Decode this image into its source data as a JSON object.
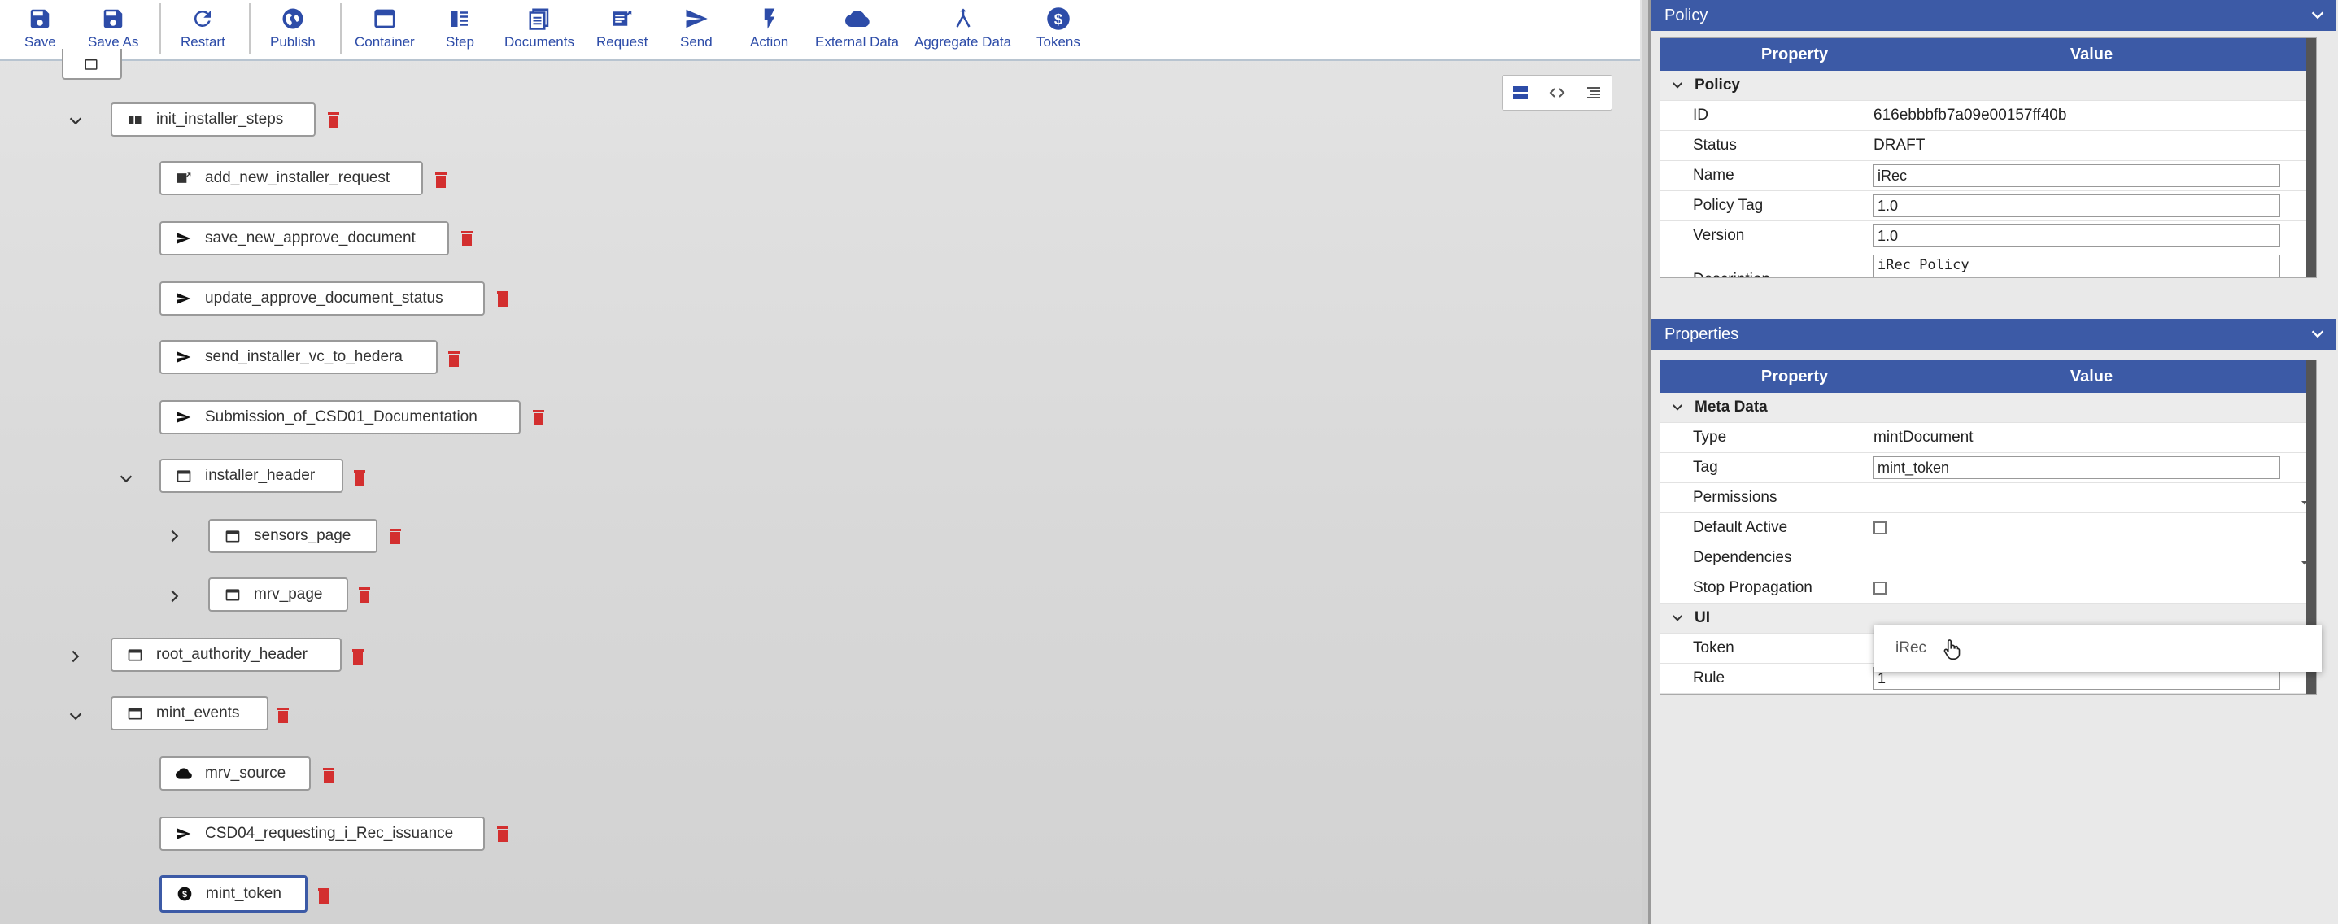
{
  "toolbar": {
    "items": [
      {
        "label": "Save",
        "icon": "save-icon"
      },
      {
        "label": "Save As",
        "icon": "save-as-icon"
      },
      {
        "label": "Restart",
        "icon": "restart-icon"
      },
      {
        "label": "Publish",
        "icon": "globe-icon"
      },
      {
        "label": "Container",
        "icon": "container-icon"
      },
      {
        "label": "Step",
        "icon": "step-icon"
      },
      {
        "label": "Documents",
        "icon": "documents-icon"
      },
      {
        "label": "Request",
        "icon": "request-icon"
      },
      {
        "label": "Send",
        "icon": "send-icon"
      },
      {
        "label": "Action",
        "icon": "lightning-icon"
      },
      {
        "label": "External Data",
        "icon": "cloud-icon"
      },
      {
        "label": "Aggregate Data",
        "icon": "merge-icon"
      },
      {
        "label": "Tokens",
        "icon": "dollar-icon"
      }
    ]
  },
  "tree": {
    "nodes": [
      {
        "label": "init_installer_steps"
      },
      {
        "label": "add_new_installer_request"
      },
      {
        "label": "save_new_approve_document"
      },
      {
        "label": "update_approve_document_status"
      },
      {
        "label": "send_installer_vc_to_hedera"
      },
      {
        "label": "Submission_of_CSD01_Documentation"
      },
      {
        "label": "installer_header"
      },
      {
        "label": "sensors_page"
      },
      {
        "label": "mrv_page"
      },
      {
        "label": "root_authority_header"
      },
      {
        "label": "mint_events"
      },
      {
        "label": "mrv_source"
      },
      {
        "label": "CSD04_requesting_i_Rec_issuance"
      },
      {
        "label": "mint_token"
      }
    ]
  },
  "policy_panel": {
    "title": "Policy",
    "col_property": "Property",
    "col_value": "Value",
    "group": "Policy",
    "rows": [
      {
        "key": "ID",
        "value": "616ebbbfb7a09e00157ff40b"
      },
      {
        "key": "Status",
        "value": "DRAFT"
      },
      {
        "key": "Name",
        "value": "iRec"
      },
      {
        "key": "Policy Tag",
        "value": "1.0"
      },
      {
        "key": "Version",
        "value": "1.0"
      },
      {
        "key": "Description",
        "value": "iRec Policy"
      }
    ]
  },
  "properties_panel": {
    "title": "Properties",
    "col_property": "Property",
    "col_value": "Value",
    "group_meta": "Meta Data",
    "group_ui": "UI",
    "rows": [
      {
        "key": "Type",
        "value": "mintDocument"
      },
      {
        "key": "Tag",
        "value": "mint_token"
      },
      {
        "key": "Permissions",
        "value": ""
      },
      {
        "key": "Default Active",
        "value": ""
      },
      {
        "key": "Dependencies",
        "value": ""
      },
      {
        "key": "Stop Propagation",
        "value": ""
      },
      {
        "key": "Token",
        "value": ""
      },
      {
        "key": "Rule",
        "value": "1"
      }
    ],
    "dropdown_option": "iRec"
  },
  "colors": {
    "accent": "#3c5aa6",
    "toolbar_icon": "#2d4ca8",
    "trash": "#d32f2f"
  }
}
